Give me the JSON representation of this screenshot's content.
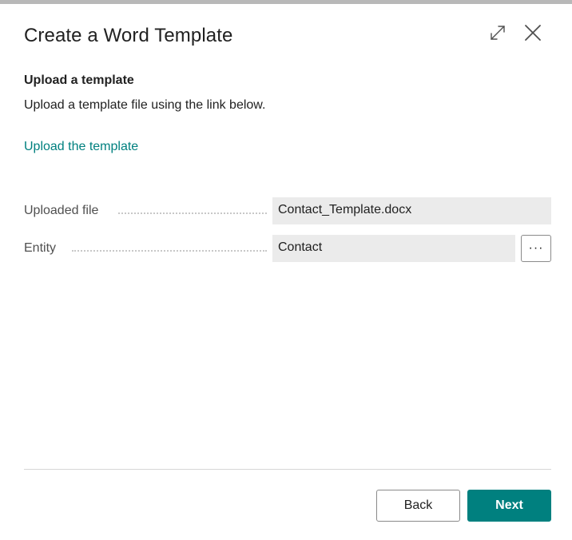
{
  "dialog": {
    "title": "Create a Word Template"
  },
  "section": {
    "heading": "Upload a template",
    "description": "Upload a template file using the link below.",
    "link_label": "Upload the template"
  },
  "fields": {
    "uploaded_file": {
      "label": "Uploaded file",
      "value": "Contact_Template.docx"
    },
    "entity": {
      "label": "Entity",
      "value": "Contact",
      "lookup_label": "···"
    }
  },
  "footer": {
    "back_label": "Back",
    "next_label": "Next"
  },
  "colors": {
    "accent": "#00807f",
    "field_background": "#ebebeb",
    "text": "#212121"
  },
  "icons": {
    "expand": "expand-icon",
    "close": "close-icon"
  }
}
